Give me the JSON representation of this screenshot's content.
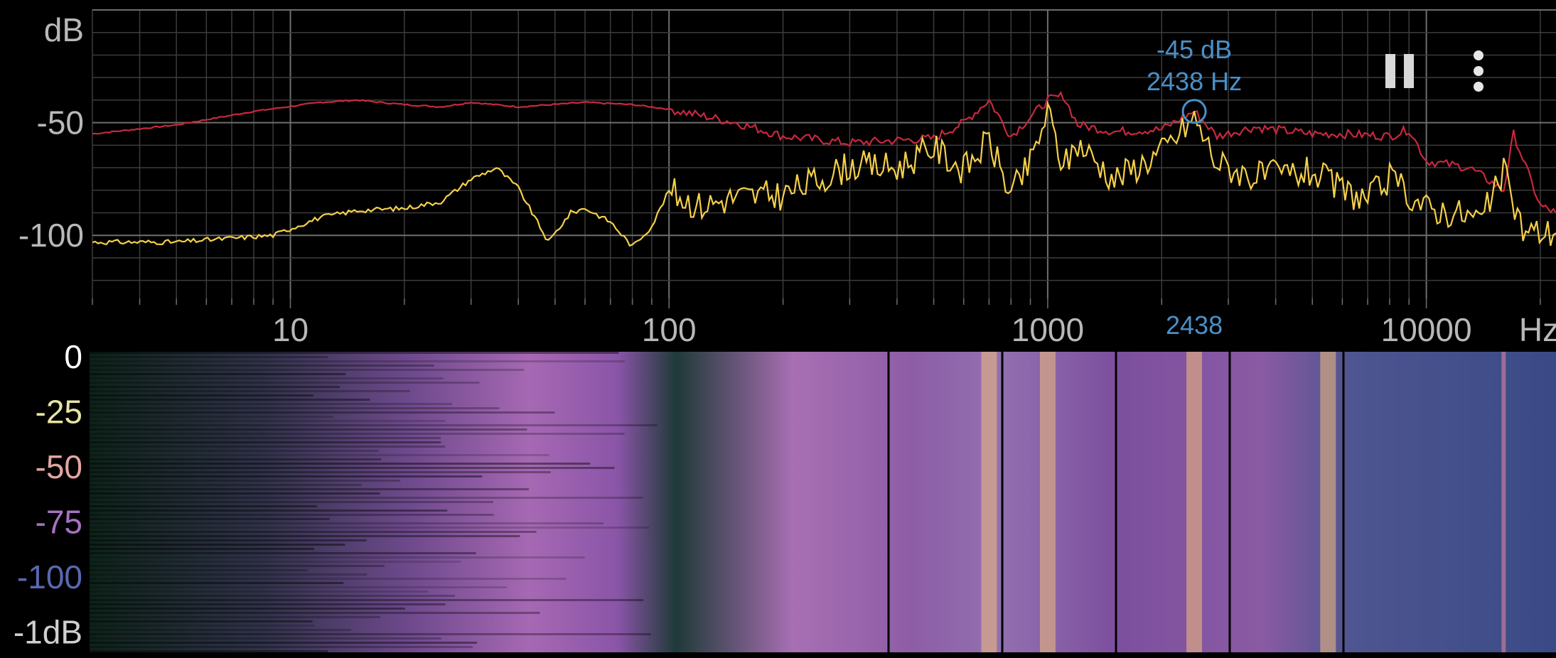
{
  "colors": {
    "background": "#000000",
    "grid_major": "#6e6e6e",
    "grid_minor": "#3c3c3c",
    "axis_text": "#b8b8b8",
    "max_hold_line": "#c8283e",
    "live_line": "#f5d04a",
    "peak_marker": "#4a90c9",
    "spectrogram_low": "#0c1f17",
    "spectrogram_mid": "#8a55a8",
    "spectrogram_high": "#f2c07a"
  },
  "toolbar": {
    "pause_icon": "pause-icon",
    "more_icon": "overflow-menu-icon"
  },
  "peak": {
    "db_text": "-45 dB",
    "hz_text": "2438 Hz",
    "axis_text": "2438",
    "freq": 2438,
    "db": -45
  },
  "spectrogram": {
    "scale_labels": [
      "0",
      "-25",
      "-50",
      "-75",
      "-100",
      "-1dB"
    ],
    "scale_label_colors": [
      "#ffffff",
      "#e9e3a6",
      "#e2a6a0",
      "#a771c2",
      "#5a68b0",
      "#cfcfcf"
    ],
    "bright_bands_hz": [
      700,
      1000,
      2438,
      5500,
      16000
    ]
  },
  "chart_data": {
    "type": "line",
    "xscale": "log",
    "xlim": [
      3,
      22000
    ],
    "ylim": [
      -128,
      0
    ],
    "x_tick_labels": [
      "10",
      "100",
      "1000",
      "10000",
      "Hz"
    ],
    "y_tick_labels": [
      "dB",
      "-50",
      "-100"
    ],
    "grid": true,
    "series": [
      {
        "role": "max-hold",
        "x": [
          3,
          5,
          8,
          12,
          15,
          20,
          25,
          30,
          40,
          60,
          80,
          100,
          150,
          200,
          300,
          500,
          600,
          700,
          800,
          1000,
          1100,
          1200,
          1500,
          2000,
          2438,
          2800,
          3500,
          5000,
          6000,
          8000,
          9000,
          10000,
          13000,
          16000,
          17000,
          20000,
          22000
        ],
        "values": [
          -55,
          -51,
          -45,
          -41,
          -40,
          -42,
          -43,
          -41,
          -43,
          -41,
          -42,
          -44,
          -50,
          -56,
          -59,
          -57,
          -50,
          -40,
          -56,
          -40,
          -38,
          -51,
          -54,
          -53,
          -45,
          -56,
          -52,
          -55,
          -55,
          -56,
          -53,
          -67,
          -70,
          -80,
          -55,
          -87,
          -90
        ]
      },
      {
        "role": "live",
        "x": [
          3,
          5,
          9,
          12,
          15,
          20,
          25,
          30,
          35,
          40,
          48,
          55,
          60,
          70,
          80,
          90,
          100,
          120,
          150,
          200,
          250,
          300,
          400,
          500,
          600,
          700,
          800,
          900,
          1000,
          1100,
          1200,
          1500,
          2000,
          2438,
          2800,
          3500,
          5000,
          6000,
          7000,
          8000,
          10000,
          12000,
          14000,
          16000,
          18000,
          22000
        ],
        "values": [
          -103,
          -103,
          -100,
          -92,
          -89,
          -88,
          -85,
          -75,
          -70,
          -79,
          -103,
          -90,
          -88,
          -94,
          -105,
          -96,
          -80,
          -87,
          -83,
          -82,
          -75,
          -69,
          -70,
          -61,
          -71,
          -58,
          -82,
          -68,
          -45,
          -70,
          -59,
          -75,
          -63,
          -48,
          -68,
          -74,
          -72,
          -80,
          -84,
          -75,
          -88,
          -90,
          -93,
          -72,
          -98,
          -99
        ]
      }
    ]
  }
}
